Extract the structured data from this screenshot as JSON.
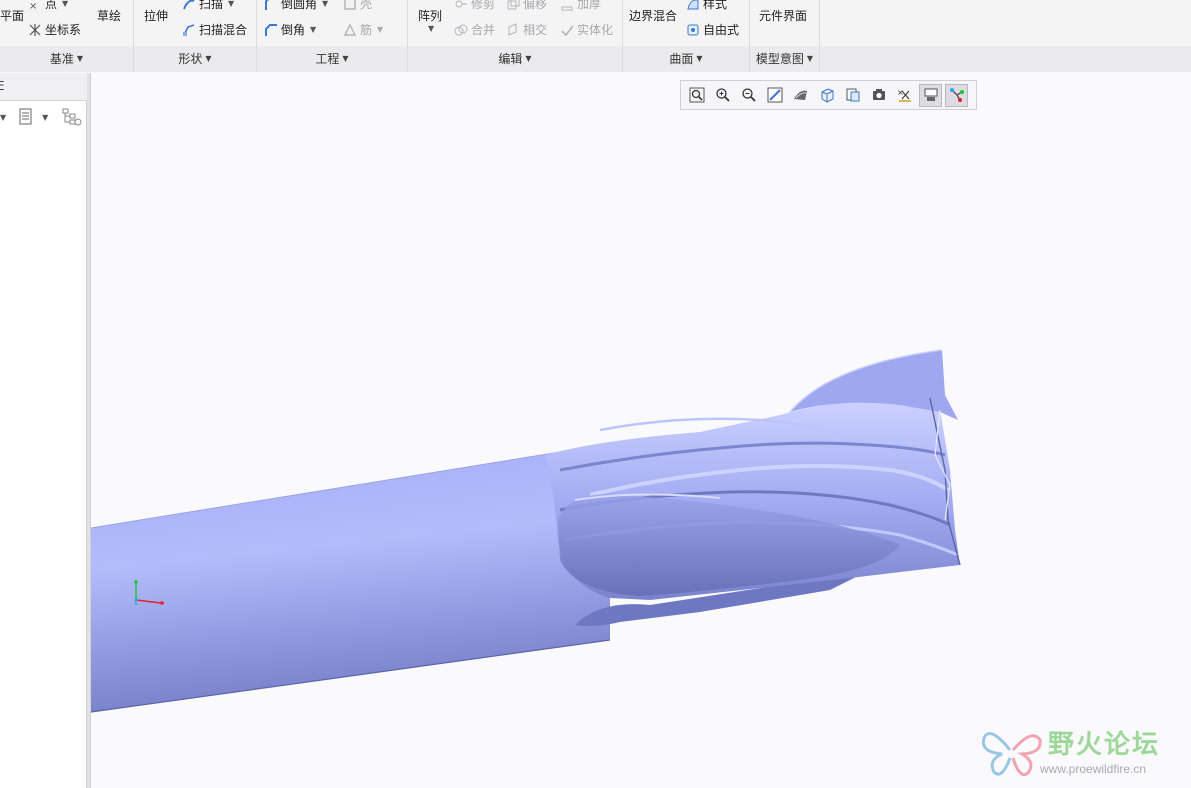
{
  "ribbon": {
    "datum": {
      "plane_label": "平面",
      "point_label": "点",
      "csys_label": "坐标系",
      "sketch_label": "草绘",
      "group_label": "基准"
    },
    "shapes": {
      "extrude_label": "拉伸",
      "sweep_label": "扫描",
      "swept_blend_label": "扫描混合",
      "group_label": "形状"
    },
    "engineering": {
      "round_label": "倒圆角",
      "chamfer_label": "倒角",
      "shell_label": "壳",
      "rib_label": "筋",
      "group_label": "工程"
    },
    "editing": {
      "pattern_label": "阵列",
      "trim_label": "修剪",
      "offset_label": "偏移",
      "thicken_label": "加厚",
      "merge_label": "合并",
      "intersect_label": "相交",
      "solidify_label": "实体化",
      "group_label": "编辑"
    },
    "surfaces": {
      "boundary_blend_label": "边界混合",
      "style_label": "样式",
      "freestyle_label": "自由式",
      "group_label": "曲面"
    },
    "model_intent": {
      "component_interface_label": "元件界面",
      "group_label": "模型意图"
    }
  },
  "left_panel": {
    "tab_fragment": "E"
  },
  "view_toolbar": {
    "buttons": [
      "refit-icon",
      "zoom-in-icon",
      "zoom-out-icon",
      "repaint-icon",
      "display-style-icon",
      "saved-orientations-icon",
      "view-manager-icon",
      "perspective-icon",
      "datum-display-icon",
      "annotation-display-icon",
      "spin-center-icon"
    ]
  },
  "colors": {
    "model_body": "#a3acf2",
    "model_shadow": "#6f78c0",
    "model_highlight": "#cdd3ff",
    "watermark_green": "#9fd79b"
  },
  "watermark": {
    "title": "野火论坛",
    "url": "www.proewildfire.cn"
  }
}
